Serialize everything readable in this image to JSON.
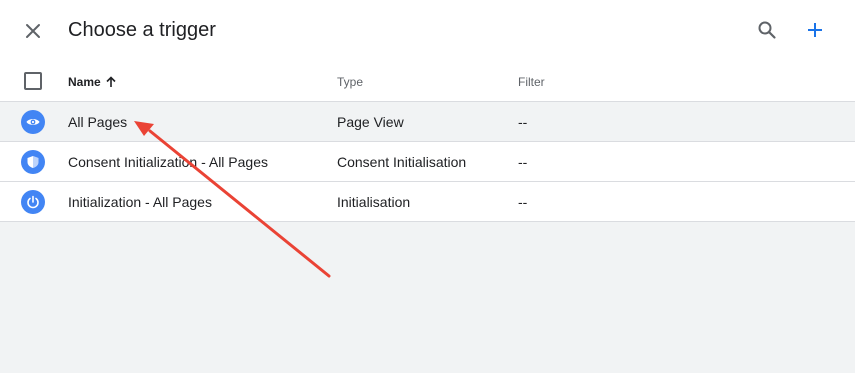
{
  "header": {
    "title": "Choose a trigger",
    "close_icon": "close-icon",
    "search_icon": "search-icon",
    "add_icon": "add-icon"
  },
  "columns": {
    "name": "Name",
    "name_sort_icon": "arrow-up-icon",
    "type": "Type",
    "filter": "Filter"
  },
  "rows": [
    {
      "name": "All Pages",
      "type": "Page View",
      "filter": "--",
      "icon": "eye-icon",
      "selected": true
    },
    {
      "name": "Consent Initialization - All Pages",
      "type": "Consent Initialisation",
      "filter": "--",
      "icon": "shield-icon",
      "selected": false
    },
    {
      "name": "Initialization - All Pages",
      "type": "Initialisation",
      "filter": "--",
      "icon": "power-icon",
      "selected": false
    }
  ],
  "annotation": {
    "type": "arrow",
    "color": "#ea4335",
    "target": "All Pages"
  },
  "colors": {
    "accent": "#1a73e8",
    "icon_bg": "#4285f4",
    "page_bg": "#f1f3f4"
  }
}
